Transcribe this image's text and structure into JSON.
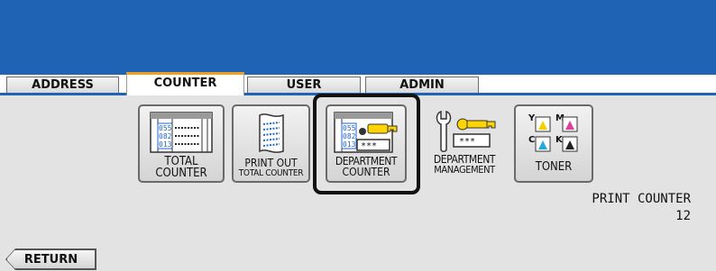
{
  "tabs": [
    {
      "label": "ADDRESS",
      "active": false
    },
    {
      "label": "COUNTER",
      "active": true
    },
    {
      "label": "USER",
      "active": false
    },
    {
      "label": "ADMIN",
      "active": false
    }
  ],
  "buttons": {
    "total_counter": {
      "line1": "TOTAL",
      "line2": "COUNTER",
      "icon": "counter-table-icon"
    },
    "print_out_total_counter": {
      "line1": "PRINT OUT",
      "line2": "TOTAL COUNTER",
      "icon": "printout-sheet-icon"
    },
    "department_counter": {
      "line1": "DEPARTMENT",
      "line2": "COUNTER",
      "icon": "department-key-icon",
      "icon_text": "***"
    },
    "department_management": {
      "line1": "DEPARTMENT",
      "line2": "MANAGEMENT",
      "icon": "wrench-key-icon",
      "icon_text": "***"
    },
    "toner": {
      "line1": "TONER",
      "icon": "toner-cmyk-icon",
      "icon_letters": [
        "Y",
        "M",
        "C",
        "K"
      ]
    }
  },
  "icon_numbers": [
    "055",
    "082",
    "013"
  ],
  "print_counter": {
    "title": "PRINT COUNTER",
    "value": "12"
  },
  "return_button": {
    "label": "RETURN"
  },
  "colors": {
    "banner": "#1e63b4",
    "active_tab_accent": "#f0a020",
    "panel": "#e3e3e3",
    "highlight": "#111111"
  }
}
